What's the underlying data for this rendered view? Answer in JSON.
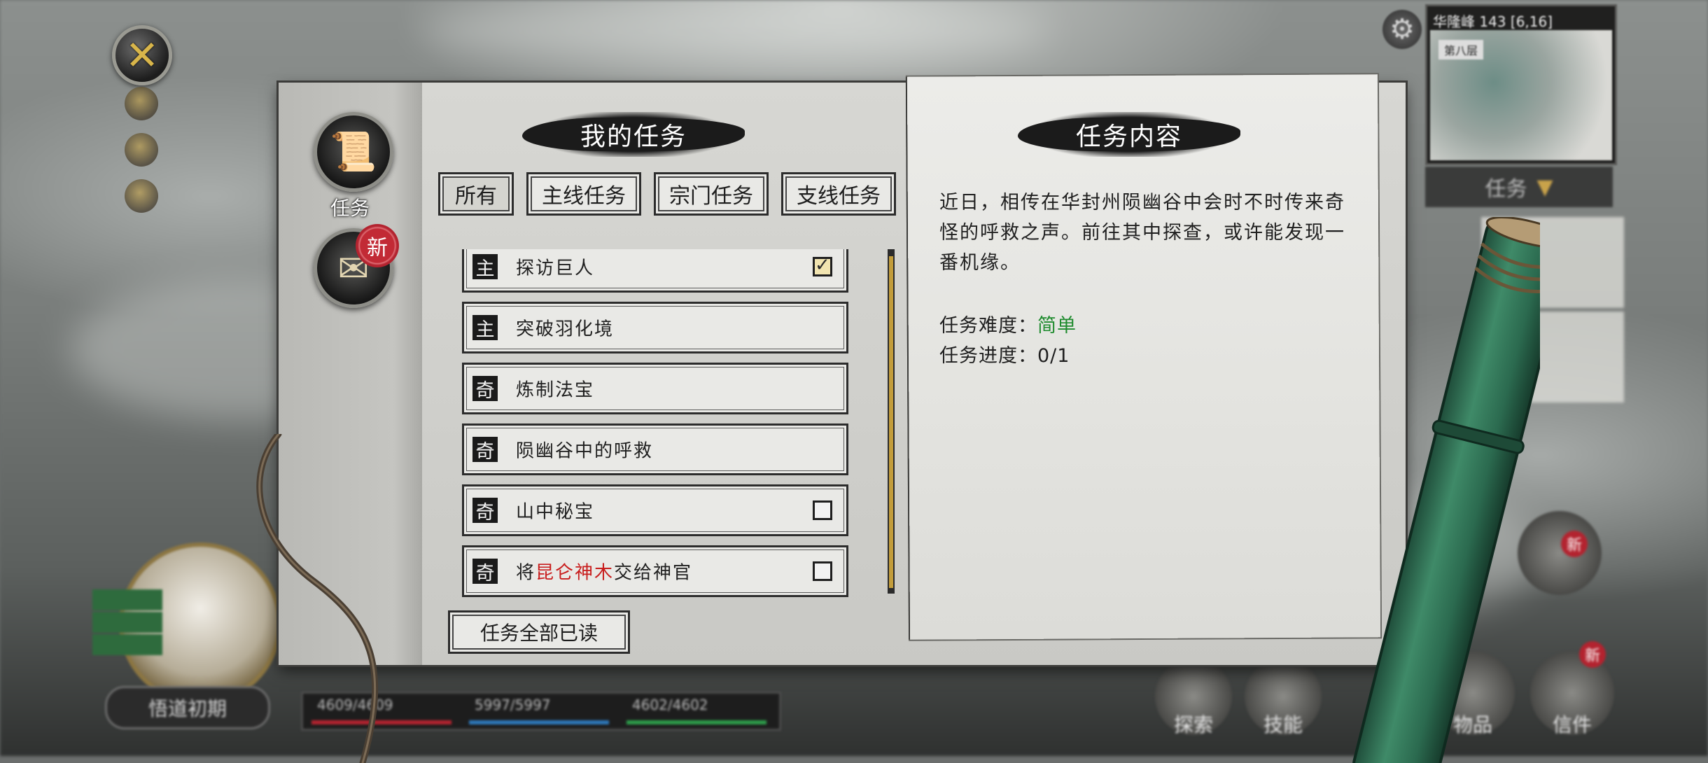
{
  "panel": {
    "left_title": "我的任务",
    "right_title": "任务内容",
    "filter_tabs": [
      {
        "label": "所有",
        "active": true
      },
      {
        "label": "主线任务",
        "active": false
      },
      {
        "label": "宗门任务",
        "active": false
      },
      {
        "label": "支线任务",
        "active": false
      }
    ],
    "quests": [
      {
        "type": "主",
        "name_parts": [
          "探访巨人"
        ],
        "checkbox": "checked"
      },
      {
        "type": "主",
        "name_parts": [
          "突破羽化境"
        ],
        "checkbox": "none"
      },
      {
        "type": "奇",
        "name_parts": [
          "炼制法宝"
        ],
        "checkbox": "none"
      },
      {
        "type": "奇",
        "name_parts": [
          "陨幽谷中的呼救"
        ],
        "checkbox": "none"
      },
      {
        "type": "奇",
        "name_parts": [
          "山中秘宝"
        ],
        "checkbox": "unchecked"
      },
      {
        "type": "奇",
        "name_parts": [
          "将",
          "昆仑神木",
          "交给神官"
        ],
        "highlight_index": 1,
        "checkbox": "unchecked"
      }
    ],
    "read_all_button": "任务全部已读",
    "detail": {
      "description": "近日，相传在华封州陨幽谷中会时不时传来奇怪的呼救之声。前往其中探查，或许能发现一番机缘。",
      "difficulty_label": "任务难度：",
      "difficulty_value": "简单",
      "progress_label": "任务进度：",
      "progress_value": "0/1"
    }
  },
  "side_nav": {
    "task_label": "任务",
    "new_badge": "新"
  },
  "colors": {
    "highlight_red": "#c81c1c",
    "difficulty_green": "#1f8b2e",
    "scroll_gold": "#c39d3b",
    "badge_red": "#b3232f"
  },
  "background_hud": {
    "minimap_location": "华隆峰 143 [6,16]",
    "minimap_tag": "第八层",
    "task_dropdown": "任务",
    "realm": "悟道初期",
    "hp": "4609/4609",
    "mp": "5997/5997",
    "stamina": "4602/4602",
    "bottom_buttons": [
      "探索",
      "技能",
      "物品",
      "信件"
    ],
    "new_badges": [
      "新",
      "新"
    ]
  }
}
